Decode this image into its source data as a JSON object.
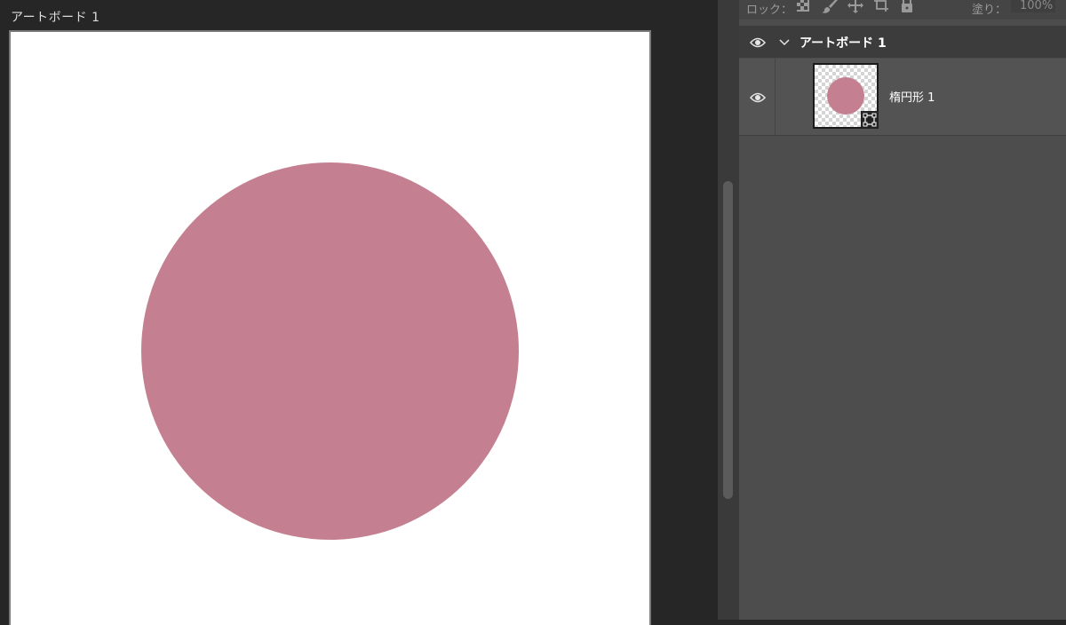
{
  "colors": {
    "ellipse_fill": "#c48090",
    "canvas_bg": "#262626",
    "panel_bg": "#4d4d4d"
  },
  "canvas": {
    "artboard_title": "アートボード 1"
  },
  "layers_panel": {
    "lock_label": "ロック：",
    "lock_icons": [
      "lock-transparent-pixels-icon",
      "lock-image-pixels-icon",
      "lock-position-icon",
      "lock-artboard-icon",
      "lock-all-icon"
    ],
    "fill_label": "塗り：",
    "fill_value": "100%",
    "group": {
      "name": "アートボード 1",
      "visible_icon": "eye-icon",
      "toggle_icon": "chevron-down-icon"
    },
    "layer": {
      "name": "楕円形 1",
      "visible_icon": "eye-icon",
      "badge_icon": "shape-layer-icon"
    }
  }
}
